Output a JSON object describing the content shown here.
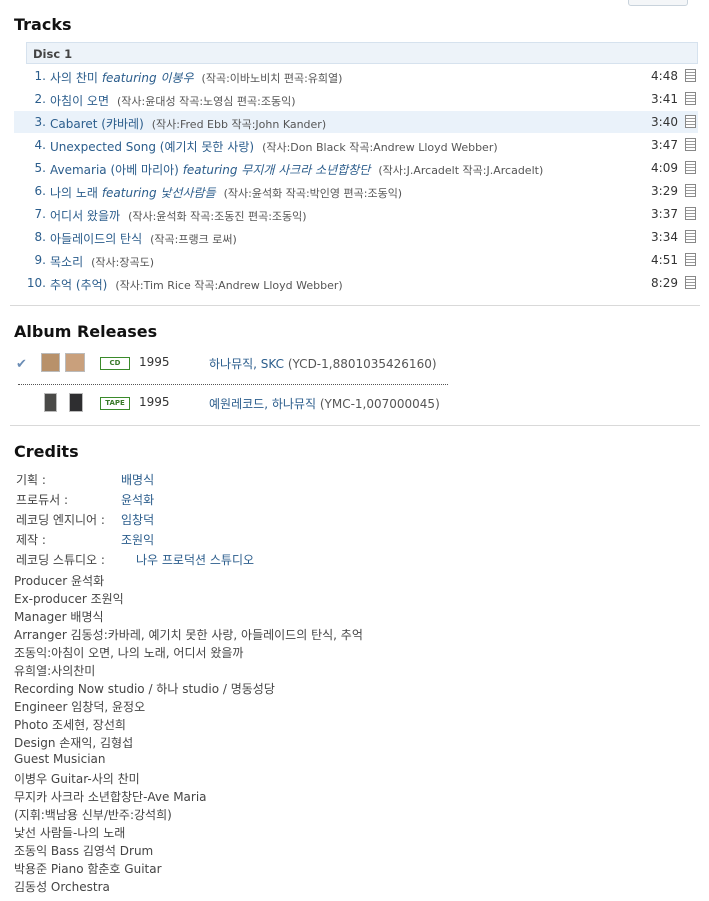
{
  "tracks": {
    "heading": "Tracks",
    "disc_label": "Disc 1",
    "items": [
      {
        "num": "1.",
        "title": "사의 찬미",
        "featuring_label": "featuring",
        "featuring": "이봉우",
        "credit": "(작곡:이바노비치 편곡:유희열)",
        "duration": "4:48"
      },
      {
        "num": "2.",
        "title": "아침이 오면",
        "featuring_label": "",
        "featuring": "",
        "credit": "(작사:윤대성 작곡:노영심 편곡:조동익)",
        "duration": "3:41"
      },
      {
        "num": "3.",
        "title": "Cabaret (캬바레)",
        "featuring_label": "",
        "featuring": "",
        "credit": "(작사:Fred Ebb 작곡:John Kander)",
        "duration": "3:40"
      },
      {
        "num": "4.",
        "title": "Unexpected Song (예기치 못한 사랑)",
        "featuring_label": "",
        "featuring": "",
        "credit": "(작사:Don Black 작곡:Andrew Lloyd Webber)",
        "duration": "3:47"
      },
      {
        "num": "5.",
        "title": "Avemaria (아베 마리아)",
        "featuring_label": "featuring",
        "featuring": "무지개 사크라 소년합창단",
        "credit": "(작사:J.Arcadelt 작곡:J.Arcadelt)",
        "duration": "4:09"
      },
      {
        "num": "6.",
        "title": "나의 노래",
        "featuring_label": "featuring",
        "featuring": "낯선사람들",
        "credit": "(작사:윤석화 작곡:박인영 편곡:조동익)",
        "duration": "3:29"
      },
      {
        "num": "7.",
        "title": "어디서 왔을까",
        "featuring_label": "",
        "featuring": "",
        "credit": "(작사:윤석화 작곡:조동진 편곡:조동익)",
        "duration": "3:37"
      },
      {
        "num": "8.",
        "title": "아들레이드의 탄식",
        "featuring_label": "",
        "featuring": "",
        "credit": "(작곡:프랭크 로써)",
        "duration": "3:34"
      },
      {
        "num": "9.",
        "title": "목소리",
        "featuring_label": "",
        "featuring": "",
        "credit": "(작사:장곡도)",
        "duration": "4:51"
      },
      {
        "num": "10.",
        "title": "추억 (추억)",
        "featuring_label": "",
        "featuring": "",
        "credit": "(작사:Tim Rice 작곡:Andrew Lloyd Webber)",
        "duration": "8:29"
      }
    ],
    "highlighted_index": 2
  },
  "releases": {
    "heading": "Album Releases",
    "items": [
      {
        "format": "CD",
        "year": "1995",
        "labels": "하나뮤직, SKC",
        "code": "(YCD-1,8801035426160)",
        "check_icon": "checkmark-icon",
        "cover_colors": [
          "#b8916a",
          "#c9a07c"
        ]
      },
      {
        "format": "TAPE",
        "year": "1995",
        "labels": "예원레코드, 하나뮤직",
        "code": "(YMC-1,007000045)",
        "check_icon": "",
        "cover_colors": [
          "#4a4a48",
          "#2e2e30"
        ]
      }
    ]
  },
  "credits": {
    "heading": "Credits",
    "rows": [
      {
        "key": "기획 :",
        "value": "배명식"
      },
      {
        "key": "프로듀서 :",
        "value": "윤석화"
      },
      {
        "key": "레코딩 엔지니어 :",
        "value": "임창덕"
      },
      {
        "key": "제작 :",
        "value": "조원익"
      },
      {
        "key": "레코딩 스튜디오 :",
        "value": "나우 프로덕션 스튜디오"
      }
    ],
    "notes": [
      "Producer 윤석화",
      "Ex-producer 조원익",
      "Manager 배명식",
      "Arranger 김동성:카바레, 예기치 못한 사랑, 아들레이드의 탄식, 추억",
      "조동익:아침이 오면, 나의 노래, 어디서 왔을까",
      "유희열:사의찬미",
      "Recording Now studio / 하나 studio / 명동성당",
      "Engineer 임창덕, 윤정오",
      "Photo 조세현, 장선희",
      "Design 손재익, 김형섭",
      "Guest Musician",
      "이병우 Guitar-사의 찬미",
      "무지카 사크라 소년합창단-Ave Maria",
      "(지휘:백남용 신부/반주:강석희)",
      "낯선 사람들-나의 노래",
      "조동익 Bass 김영석 Drum",
      "박용준 Piano 함춘호 Guitar",
      "김동성 Orchestra"
    ]
  }
}
